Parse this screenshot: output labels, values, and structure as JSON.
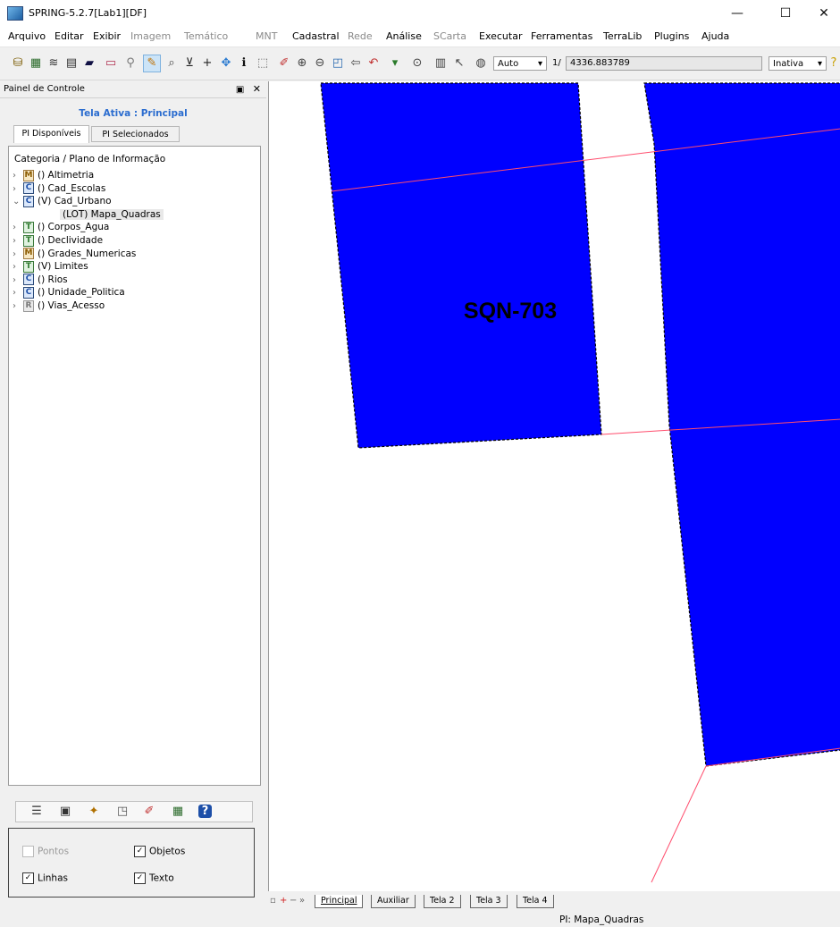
{
  "window": {
    "title": "SPRING-5.2.7[Lab1][DF]",
    "minimize": "—",
    "maximize": "☐",
    "close": "✕"
  },
  "menu": [
    {
      "label": "Arquivo",
      "enabled": true
    },
    {
      "label": "Editar",
      "enabled": true
    },
    {
      "label": "Exibir",
      "enabled": true
    },
    {
      "label": "Imagem",
      "enabled": false
    },
    {
      "label": "Temático",
      "enabled": false
    },
    {
      "label": "MNT",
      "enabled": false
    },
    {
      "label": "Cadastral",
      "enabled": true
    },
    {
      "label": "Rede",
      "enabled": false
    },
    {
      "label": "Análise",
      "enabled": true
    },
    {
      "label": "SCarta",
      "enabled": false
    },
    {
      "label": "Executar",
      "enabled": true
    },
    {
      "label": "Ferramentas",
      "enabled": true
    },
    {
      "label": "TerraLib",
      "enabled": true
    },
    {
      "label": "Plugins",
      "enabled": true
    },
    {
      "label": "Ajuda",
      "enabled": true
    }
  ],
  "toolbar": {
    "zoom_mode": "Auto",
    "scale_prefix": "1/",
    "scale_value": "4336.883789",
    "state": "Inativa"
  },
  "panel": {
    "title": "Painel de Controle",
    "active_screen": "Tela Ativa : Principal",
    "tabs": [
      "PI Disponíveis",
      "PI Selecionados"
    ],
    "tree_header": "Categoria / Plano de Informação",
    "categories": [
      {
        "type": "M",
        "label": "() Altimetria",
        "expanded": false
      },
      {
        "type": "C",
        "label": "() Cad_Escolas",
        "expanded": false
      },
      {
        "type": "C",
        "label": "(V) Cad_Urbano",
        "expanded": true
      },
      {
        "type": "T",
        "label": "() Corpos_Agua",
        "expanded": false
      },
      {
        "type": "T",
        "label": "() Declividade",
        "expanded": false
      },
      {
        "type": "M",
        "label": "() Grades_Numericas",
        "expanded": false
      },
      {
        "type": "T",
        "label": "(V) Limites",
        "expanded": false
      },
      {
        "type": "C",
        "label": "() Rios",
        "expanded": false
      },
      {
        "type": "C",
        "label": "() Unidade_Politica",
        "expanded": false
      },
      {
        "type": "R",
        "label": "() Vias_Acesso",
        "expanded": false
      }
    ],
    "child_item": "(LOT) Mapa_Quadras",
    "options": {
      "pontos": "Pontos",
      "objetos": "Objetos",
      "linhas": "Linhas",
      "texto": "Texto"
    }
  },
  "map": {
    "label": "SQN-703",
    "fill_color": "#0000ff",
    "line_color": "#ff4d6d"
  },
  "screen_tabs": [
    "Principal",
    "Auxiliar",
    "Tela 2",
    "Tela 3",
    "Tela 4"
  ],
  "status": {
    "pi": "PI: Mapa_Quadras"
  }
}
